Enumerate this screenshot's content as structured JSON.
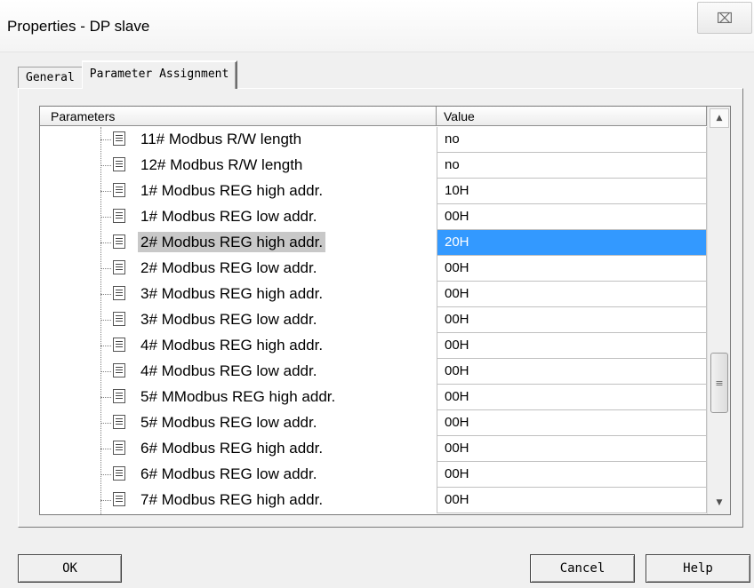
{
  "window": {
    "title": "Properties - DP slave",
    "close_glyph": "⌧"
  },
  "tabs": [
    {
      "label": "General",
      "active": false
    },
    {
      "label": "Parameter Assignment",
      "active": true
    }
  ],
  "grid": {
    "columns": {
      "parameters": "Parameters",
      "value": "Value"
    },
    "rows": [
      {
        "label": "11# Modbus R/W length",
        "value": "no",
        "selected": false
      },
      {
        "label": "12# Modbus R/W length",
        "value": "no",
        "selected": false
      },
      {
        "label": "1# Modbus REG high addr.",
        "value": "10H",
        "selected": false
      },
      {
        "label": "1# Modbus REG low addr.",
        "value": "00H",
        "selected": false
      },
      {
        "label": "2# Modbus REG high addr.",
        "value": "20H",
        "selected": true
      },
      {
        "label": "2# Modbus REG low addr.",
        "value": "00H",
        "selected": false
      },
      {
        "label": "3# Modbus REG high addr.",
        "value": "00H",
        "selected": false
      },
      {
        "label": "3# Modbus REG low addr.",
        "value": "00H",
        "selected": false
      },
      {
        "label": "4# Modbus REG high addr.",
        "value": "00H",
        "selected": false
      },
      {
        "label": "4# Modbus REG low addr.",
        "value": "00H",
        "selected": false
      },
      {
        "label": "5# MModbus REG high addr.",
        "value": "00H",
        "selected": false
      },
      {
        "label": "5# Modbus REG low addr.",
        "value": "00H",
        "selected": false
      },
      {
        "label": "6# Modbus REG high addr.",
        "value": "00H",
        "selected": false
      },
      {
        "label": "6# Modbus REG low addr.",
        "value": "00H",
        "selected": false
      },
      {
        "label": "7# Modbus REG high addr.",
        "value": "00H",
        "selected": false
      }
    ],
    "scroll": {
      "up_glyph": "▲",
      "down_glyph": "▼",
      "thumb_glyph": "≡"
    }
  },
  "buttons": {
    "ok": "OK",
    "cancel": "Cancel",
    "help": "Help"
  },
  "colors": {
    "selection": "#3399ff",
    "tree_selection": "#c8c8c8"
  }
}
